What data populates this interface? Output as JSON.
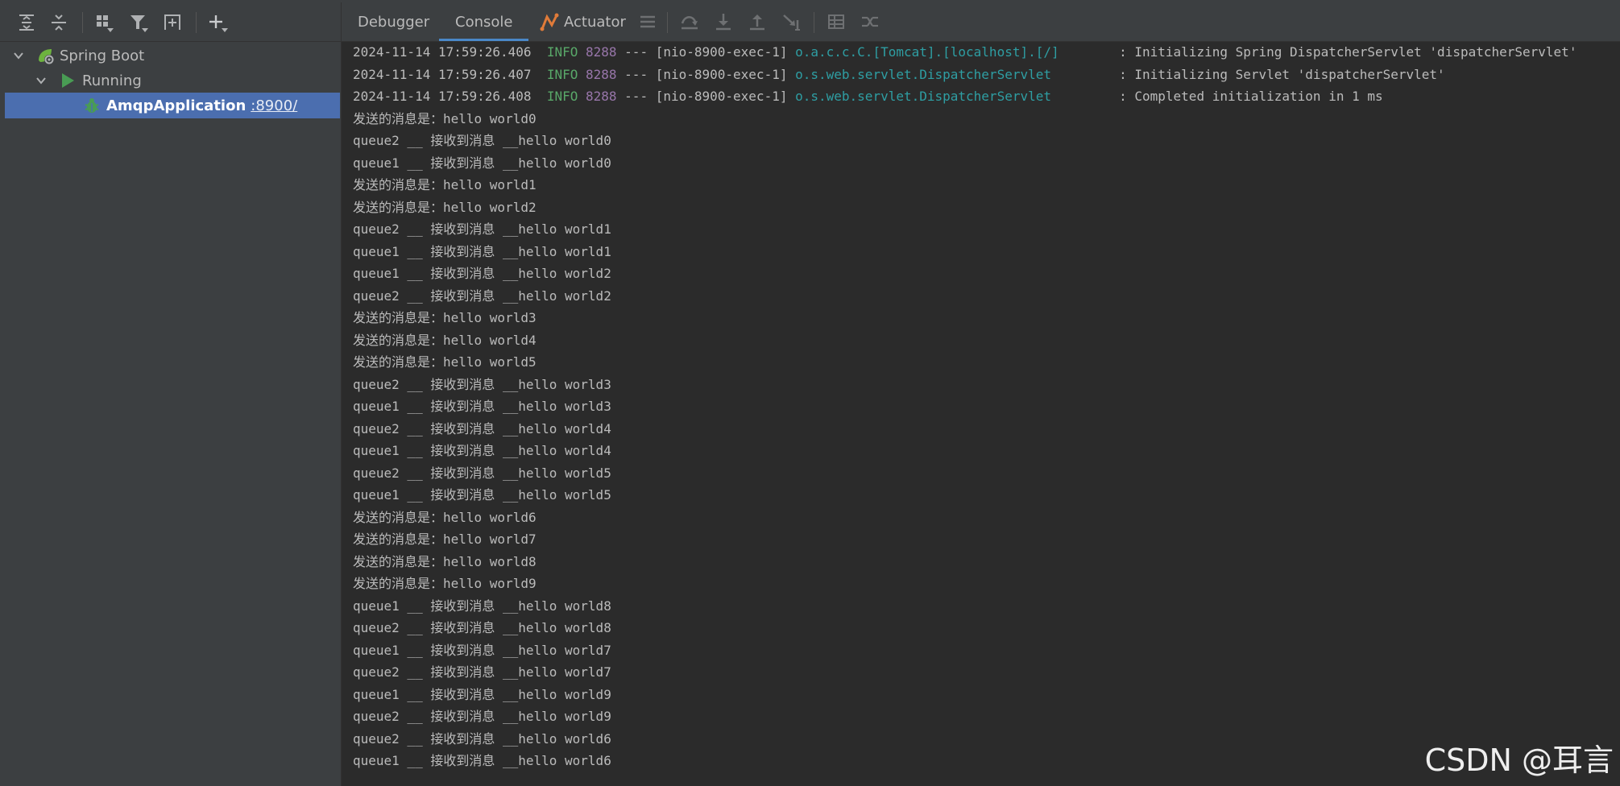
{
  "left_panel": {
    "toolbar": {
      "expand_all": "expand-all-icon",
      "collapse_all": "collapse-all-icon",
      "group_by": "group-by-icon",
      "filter": "filter-icon",
      "open_new_tab": "new-tab-icon",
      "add_service": "add-icon"
    },
    "tree": {
      "spring_boot": "Spring Boot",
      "running": "Running",
      "app_name": "AmqpApplication",
      "app_port": ":8900/"
    }
  },
  "tabs": {
    "debugger": "Debugger",
    "console": "Console",
    "actuator": "Actuator"
  },
  "log_lines": [
    {
      "ts": "2024-11-14 17:59:26.406",
      "level": "INFO",
      "pid": "8288",
      "thread": "--- [nio-8900-exec-1]",
      "logger": "o.a.c.c.C.[Tomcat].[localhost].[/]",
      "msg": ": Initializing Spring DispatcherServlet 'dispatcherServlet'"
    },
    {
      "ts": "2024-11-14 17:59:26.407",
      "level": "INFO",
      "pid": "8288",
      "thread": "--- [nio-8900-exec-1]",
      "logger": "o.s.web.servlet.DispatcherServlet",
      "msg": ": Initializing Servlet 'dispatcherServlet'"
    },
    {
      "ts": "2024-11-14 17:59:26.408",
      "level": "INFO",
      "pid": "8288",
      "thread": "--- [nio-8900-exec-1]",
      "logger": "o.s.web.servlet.DispatcherServlet",
      "msg": ": Completed initialization in 1 ms"
    }
  ],
  "output_lines": [
    "发送的消息是：hello world0",
    "queue2 __ 接收到消息 __hello world0",
    "queue1 __ 接收到消息 __hello world0",
    "发送的消息是：hello world1",
    "发送的消息是：hello world2",
    "queue2 __ 接收到消息 __hello world1",
    "queue1 __ 接收到消息 __hello world1",
    "queue1 __ 接收到消息 __hello world2",
    "queue2 __ 接收到消息 __hello world2",
    "发送的消息是：hello world3",
    "发送的消息是：hello world4",
    "发送的消息是：hello world5",
    "queue2 __ 接收到消息 __hello world3",
    "queue1 __ 接收到消息 __hello world3",
    "queue2 __ 接收到消息 __hello world4",
    "queue1 __ 接收到消息 __hello world4",
    "queue2 __ 接收到消息 __hello world5",
    "queue1 __ 接收到消息 __hello world5",
    "发送的消息是：hello world6",
    "发送的消息是：hello world7",
    "发送的消息是：hello world8",
    "发送的消息是：hello world9",
    "queue1 __ 接收到消息 __hello world8",
    "queue2 __ 接收到消息 __hello world8",
    "queue1 __ 接收到消息 __hello world7",
    "queue2 __ 接收到消息 __hello world7",
    "queue1 __ 接收到消息 __hello world9",
    "queue2 __ 接收到消息 __hello world9",
    "queue2 __ 接收到消息 __hello world6",
    "queue1 __ 接收到消息 __hello world6"
  ],
  "watermark": "CSDN @耳言",
  "colors": {
    "info_level": "#59a869",
    "pid": "#9876aa",
    "logger": "#2e9ea3",
    "selection": "#4b6eaf",
    "run_green": "#499c54"
  }
}
